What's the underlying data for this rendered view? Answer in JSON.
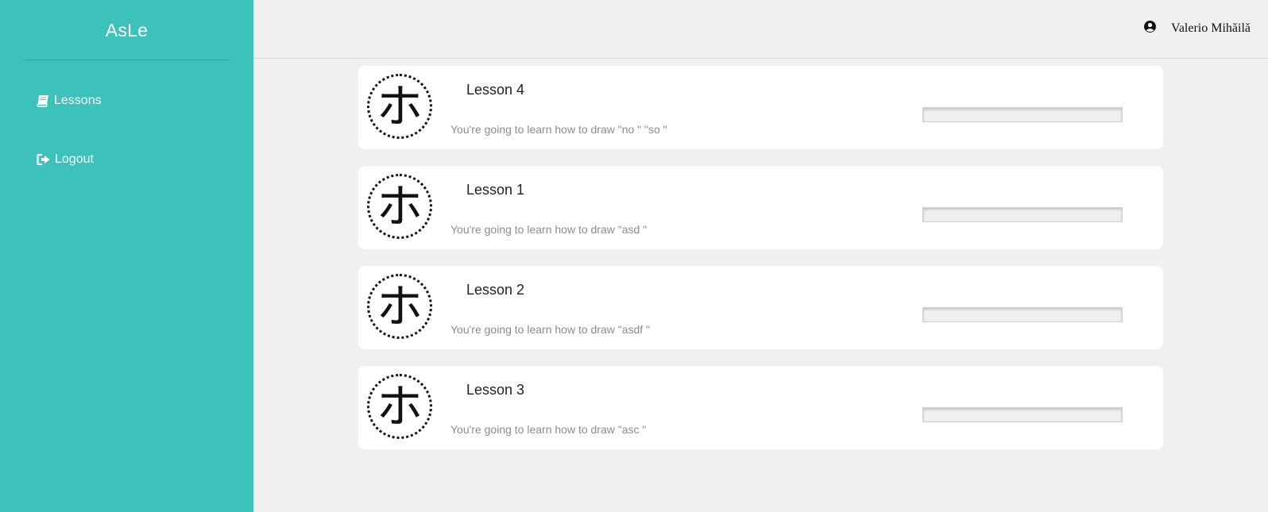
{
  "sidebar": {
    "brand": "AsLe",
    "items": [
      {
        "label": "Lessons",
        "icon": "book-icon"
      },
      {
        "label": "Logout",
        "icon": "sign-out-icon"
      }
    ]
  },
  "header": {
    "user_name": "Valerio Mihăilă",
    "user_icon": "user-circle-icon"
  },
  "lessons": [
    {
      "glyph": "ホ",
      "title": "Lesson 4",
      "description": "You're going to learn how to draw \"no \" \"so \"",
      "progress": 0
    },
    {
      "glyph": "ホ",
      "title": "Lesson 1",
      "description": "You're going to learn how to draw \"asd \"",
      "progress": 0
    },
    {
      "glyph": "ホ",
      "title": "Lesson 2",
      "description": "You're going to learn how to draw \"asdf \"",
      "progress": 0
    },
    {
      "glyph": "ホ",
      "title": "Lesson 3",
      "description": "You're going to learn how to draw \"asc \"",
      "progress": 0
    }
  ],
  "colors": {
    "sidebar": "#3cc1bb",
    "background": "#f1f0ee",
    "card": "#ffffff"
  }
}
